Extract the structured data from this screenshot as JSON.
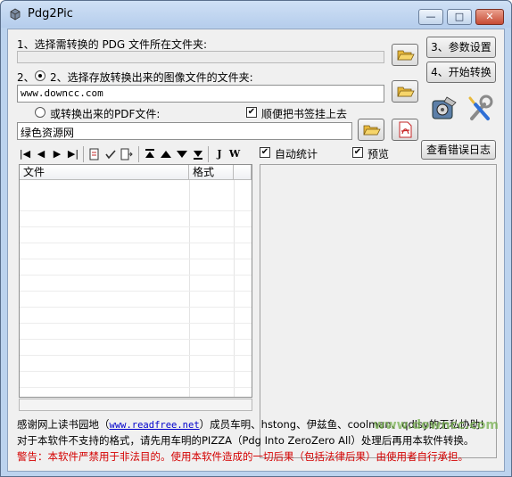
{
  "window": {
    "title": "Pdg2Pic",
    "minimize_label": "—",
    "maximize_label": "□",
    "close_label": "✕"
  },
  "step1": {
    "label": "1、选择需转换的 PDG 文件所在文件夹:",
    "path_value": ""
  },
  "step2": {
    "label": "2、选择存放转换出来的图像文件的文件夹:",
    "path_value": "www.downcc.com"
  },
  "pdf_option": {
    "label": "或转换出来的PDF文件:",
    "bookmark_label": "顺便把书签挂上去",
    "path_value": "绿色资源网"
  },
  "actions": {
    "settings_label": "3、参数设置",
    "start_label": "4、开始转换",
    "error_log_label": "查看错误日志"
  },
  "options": {
    "auto_stats_label": "自动统计",
    "preview_label": "预览"
  },
  "toolbar": {
    "first_label": "|◀",
    "prev_label": "◀",
    "next_label": "▶",
    "last_label": "▶|",
    "j_label": "J",
    "w_label": "W"
  },
  "file_list": {
    "col_file": "文件",
    "col_format": "格式"
  },
  "credits": {
    "line1_prefix": "感谢网上读书园地（",
    "line1_link": "www.readfree.net",
    "line1_suffix": "）成员车明、hstong、伊兹鱼、coolman、qdlsy的无私协助!",
    "line2": "对于本软件不支持的格式，请先用车明的PIZZA（Pdg Into ZeroZero All）处理后再用本软件转换。",
    "line3": "警告：本软件严禁用于非法目的。使用本软件造成的一切后果（包括法律后果）由使用者自行承担。"
  },
  "watermark": "www.downcc.com",
  "colors": {
    "title_bg": "#b9d1ee",
    "warning": "#d40000",
    "link": "#0000cc"
  }
}
